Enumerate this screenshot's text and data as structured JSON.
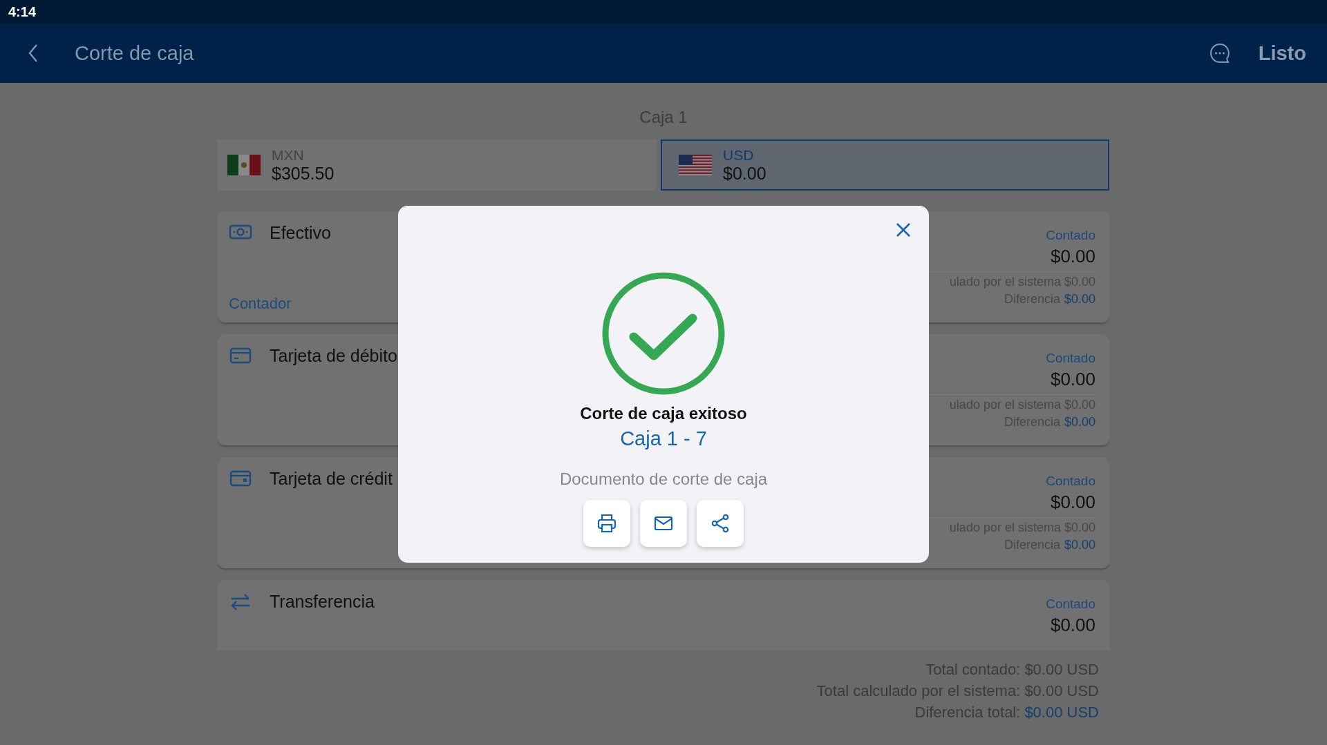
{
  "status_bar": {
    "time": "4:14"
  },
  "header": {
    "title": "Corte de caja",
    "action": "Listo"
  },
  "register": {
    "title": "Caja 1"
  },
  "currencies": [
    {
      "code": "MXN",
      "amount": "$305.50",
      "kind": "mx",
      "selected": false
    },
    {
      "code": "USD",
      "amount": "$0.00",
      "kind": "us",
      "selected": true
    }
  ],
  "payment_methods": [
    {
      "kind": "cash",
      "name": "Efectivo",
      "link": "Contador",
      "counted_label": "Contado",
      "counted": "$0.00",
      "calculated": "ulado por el sistema $0.00",
      "difference_label": "Diferencia",
      "difference": "$0.00"
    },
    {
      "kind": "debit",
      "name": "Tarjeta de débito",
      "counted_label": "Contado",
      "counted": "$0.00",
      "calculated": "ulado por el sistema $0.00",
      "difference_label": "Diferencia",
      "difference": "$0.00"
    },
    {
      "kind": "credit",
      "name": "Tarjeta de crédit",
      "counted_label": "Contado",
      "counted": "$0.00",
      "calculated": "ulado por el sistema $0.00",
      "difference_label": "Diferencia",
      "difference": "$0.00"
    },
    {
      "kind": "transfer",
      "name": "Transferencia",
      "counted_label": "Contado",
      "counted": "$0.00"
    }
  ],
  "totals": [
    {
      "label": "Total contado: $0.00 USD"
    },
    {
      "label": "Total calculado por el sistema: $0.00 USD"
    },
    {
      "label": "Diferencia total:",
      "value": "$0.00 USD"
    }
  ],
  "modal": {
    "title": "Corte de caja exitoso",
    "subtitle": "Caja 1 - 7",
    "document_label": "Documento de corte de caja",
    "actions": [
      {
        "kind": "print"
      },
      {
        "kind": "email"
      },
      {
        "kind": "share"
      }
    ]
  }
}
